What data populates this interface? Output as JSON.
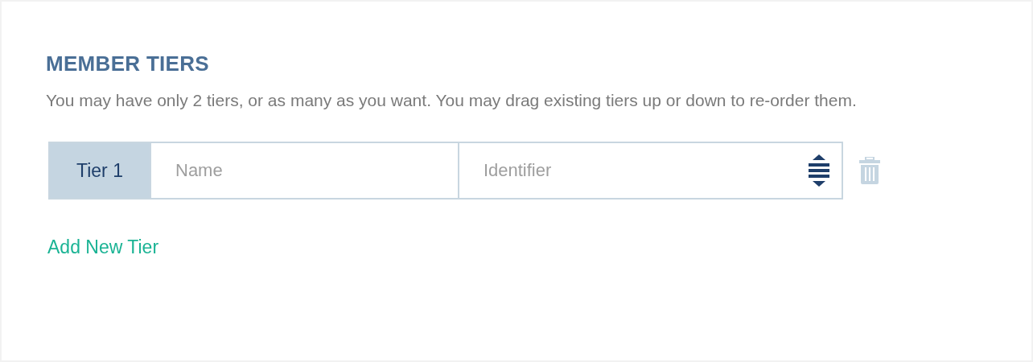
{
  "section": {
    "title": "MEMBER TIERS",
    "description": "You may have only 2 tiers, or as many as you want. You may drag existing tiers up or down to re-order them."
  },
  "tiers": [
    {
      "label": "Tier 1",
      "name": {
        "placeholder": "Name"
      },
      "identifier": {
        "placeholder": "Identifier"
      }
    }
  ],
  "add_link": "Add New Tier"
}
